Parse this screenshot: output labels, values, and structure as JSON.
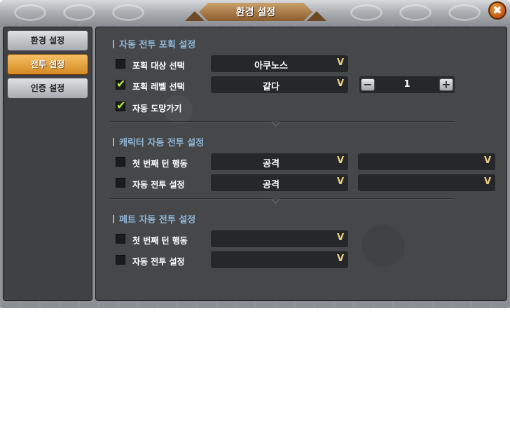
{
  "window": {
    "title": "환경 설정",
    "close_symbol": "✖"
  },
  "sidebar": {
    "tabs": [
      {
        "label": "환경 설정",
        "active": false
      },
      {
        "label": "전투 설정",
        "active": true
      },
      {
        "label": "인증 설정",
        "active": false
      }
    ]
  },
  "auto_capture": {
    "title": "자동 전투 포획 설정",
    "target": {
      "label": "포획 대상 선택",
      "checked": false,
      "value": "아쿠노스",
      "arrow": "V"
    },
    "level": {
      "label": "포획 레벨 선택",
      "checked": true,
      "value": "같다",
      "arrow": "V",
      "step_value": "1",
      "minus": "−",
      "plus": "+"
    },
    "escape": {
      "label": "자동 도망가기",
      "checked": true
    },
    "check_mark": "✔"
  },
  "character_battle": {
    "title": "캐릭터 자동 전투 설정",
    "rows": [
      {
        "label": "첫 번째 턴 행동",
        "checked": false,
        "value": "공격",
        "value2": ""
      },
      {
        "label": "자동 전투 설정",
        "checked": false,
        "value": "공격",
        "value2": ""
      }
    ],
    "arrow": "V"
  },
  "pet_battle": {
    "title": "페트 자동 전투 설정",
    "rows": [
      {
        "label": "첫 번째 턴 행동",
        "checked": false,
        "value": ""
      },
      {
        "label": "자동 전투 설정",
        "checked": false,
        "value": ""
      }
    ],
    "arrow": "V"
  },
  "colors": {
    "accent": "#d48a22",
    "section_title": "#8fb6d6",
    "check": "#b9ec33",
    "panel": "#454749"
  }
}
